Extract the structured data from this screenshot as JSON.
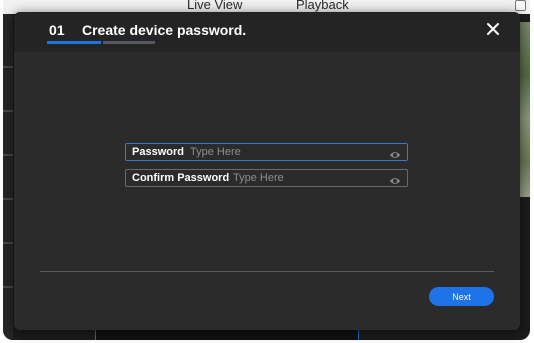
{
  "background": {
    "nav_tabs": [
      {
        "label": "Live View"
      },
      {
        "label": "Playback"
      }
    ]
  },
  "modal": {
    "step_number": "01",
    "title": "Create device password.",
    "steps_total": 2,
    "current_step": 1,
    "fields": [
      {
        "label": "Password",
        "placeholder": "Type Here",
        "value": ""
      },
      {
        "label": "Confirm Password",
        "placeholder": "Type Here",
        "value": ""
      }
    ],
    "next_label": "Next"
  },
  "colors": {
    "accent": "#1e73e8",
    "modal_bg": "#2b2b2b",
    "inactive_step": "#55595f"
  },
  "icons": {
    "close": "close-icon",
    "eye": "eye-icon"
  }
}
